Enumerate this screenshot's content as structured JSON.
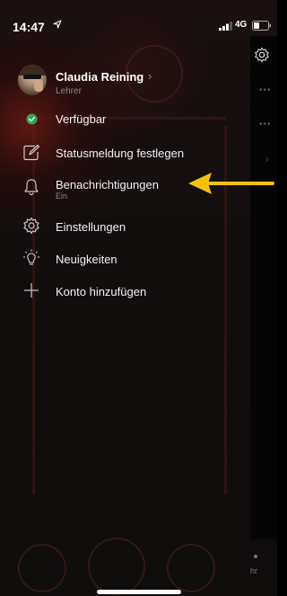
{
  "status_bar": {
    "time": "14:47",
    "network": "4G"
  },
  "profile": {
    "name": "Claudia Reining",
    "role": "Lehrer"
  },
  "menu": {
    "available_label": "Verfügbar",
    "status_message_label": "Statusmeldung festlegen",
    "notifications_label": "Benachrichtigungen",
    "notifications_state": "Ein",
    "settings_label": "Einstellungen",
    "news_label": "Neuigkeiten",
    "add_account_label": "Konto hinzufügen"
  },
  "background": {
    "peek_text": "hr"
  },
  "colors": {
    "available_green": "#2ea84a",
    "arrow_yellow": "#f4c20d",
    "text": "#f2f2f2",
    "subtext": "#888888"
  }
}
